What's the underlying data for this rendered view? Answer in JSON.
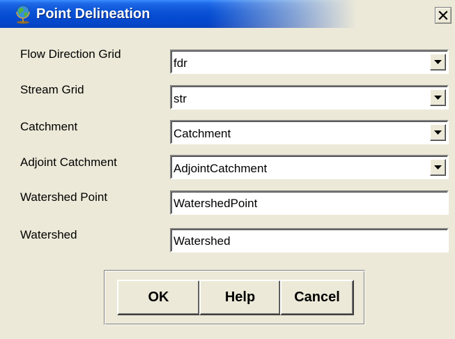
{
  "window": {
    "title": "Point Delineation",
    "close_label": "✕"
  },
  "form": {
    "rows": [
      {
        "label": "Flow Direction Grid",
        "value": "fdr",
        "type": "dropdown"
      },
      {
        "label": "Stream Grid",
        "value": "str",
        "type": "dropdown"
      },
      {
        "label": "Catchment",
        "value": "Catchment",
        "type": "dropdown"
      },
      {
        "label": "Adjoint Catchment",
        "value": "AdjointCatchment",
        "type": "dropdown"
      },
      {
        "label": "Watershed Point",
        "value": "WatershedPoint",
        "type": "text"
      },
      {
        "label": "Watershed",
        "value": "Watershed",
        "type": "text"
      }
    ]
  },
  "buttons": {
    "ok_label": "OK",
    "help_label": "Help",
    "cancel_label": "Cancel"
  },
  "icons": {
    "title_icon": "globe-icon",
    "dropdown_icon": "chevron-down-icon",
    "close_icon": "close-icon"
  },
  "colors": {
    "titlebar": "#0449CF",
    "dialog_background": "#ECE9D8"
  }
}
